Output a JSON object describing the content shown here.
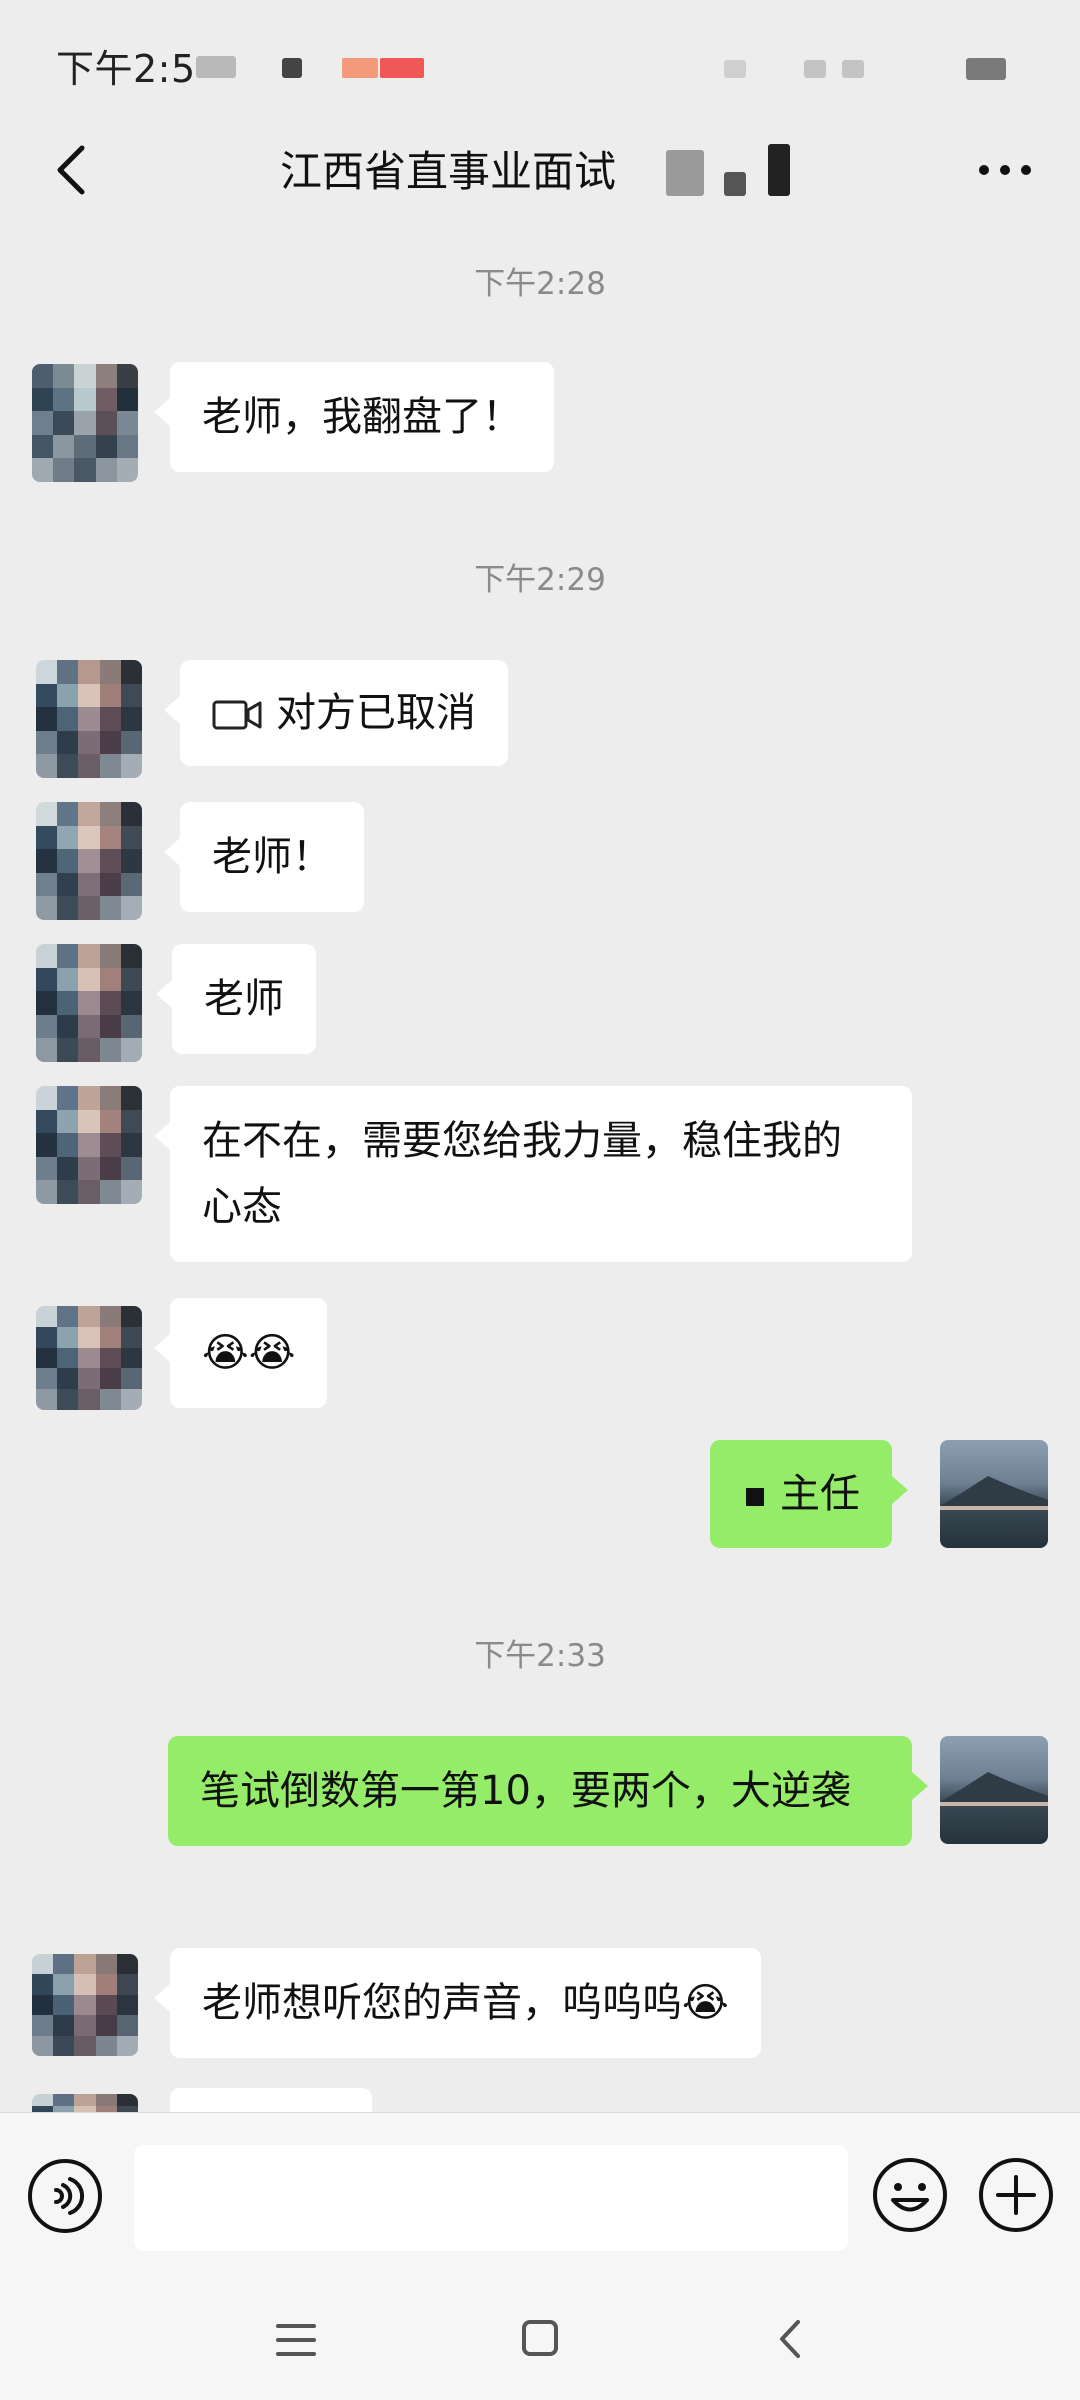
{
  "status_bar": {
    "time": "下午2:5"
  },
  "header": {
    "title": "江西省直事业面试"
  },
  "messages": [
    {
      "kind": "time",
      "text": "下午2:28"
    },
    {
      "kind": "in",
      "text": "老师，我翻盘了！"
    },
    {
      "kind": "time",
      "text": "下午2:29"
    },
    {
      "kind": "in-call",
      "text": "对方已取消",
      "icon": "video-call-icon"
    },
    {
      "kind": "in",
      "text": "老师！"
    },
    {
      "kind": "in",
      "text": "老师"
    },
    {
      "kind": "in",
      "text": "在不在，需要您给我力量，稳住我的心态"
    },
    {
      "kind": "in-emoji",
      "text": "😭😭"
    },
    {
      "kind": "out",
      "text": "主任"
    },
    {
      "kind": "time",
      "text": "下午2:33"
    },
    {
      "kind": "out",
      "text": "笔试倒数第一第10，要两个，大逆袭"
    },
    {
      "kind": "in",
      "text": "老师想听您的声音，呜呜呜😭"
    }
  ],
  "input_bar": {
    "placeholder": "",
    "left_icon": "voice-icon",
    "right_icons": [
      "emoji-icon",
      "plus-icon"
    ]
  },
  "colors": {
    "background": "#ededed",
    "outgoing_bubble": "#95ec69",
    "incoming_bubble": "#ffffff",
    "timestamp": "#8a8a8a"
  }
}
